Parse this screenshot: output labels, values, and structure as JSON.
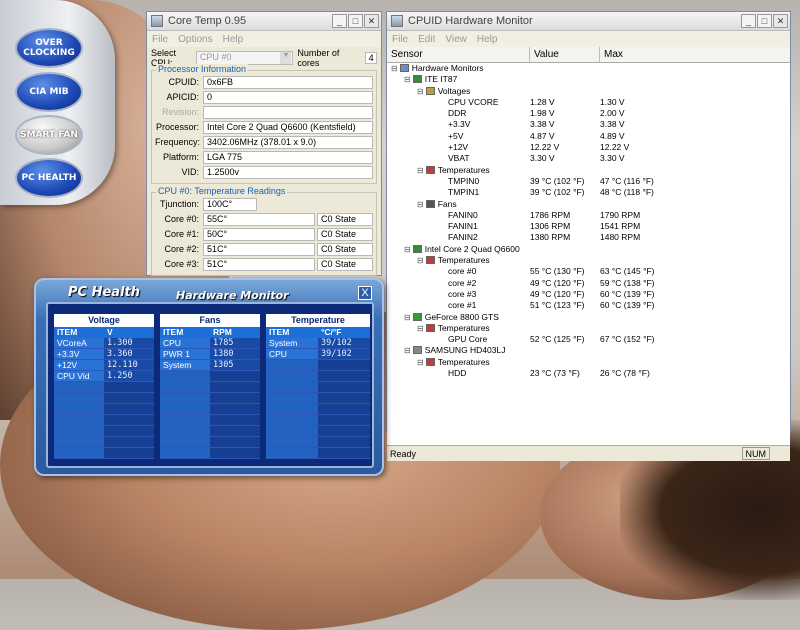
{
  "sidebar": {
    "buttons": [
      {
        "label": "OVER CLOCKING"
      },
      {
        "label": "CIA MIB"
      },
      {
        "label": "SMART FAN"
      },
      {
        "label": "PC HEALTH"
      }
    ]
  },
  "coretemp": {
    "title": "Core Temp 0.95",
    "menu": [
      "File",
      "Options",
      "Help"
    ],
    "select_cpu_label": "Select CPU:",
    "select_cpu_value": "CPU #0",
    "num_cores_label": "Number of cores",
    "num_cores_value": "4",
    "processor_info_title": "Processor Information",
    "fields": [
      {
        "label": "CPUID:",
        "value": "0x6FB"
      },
      {
        "label": "APICID:",
        "value": "0"
      },
      {
        "label": "Revision:",
        "value": ""
      },
      {
        "label": "Processor:",
        "value": "Intel Core 2 Quad Q6600 (Kentsfield)"
      },
      {
        "label": "Frequency:",
        "value": "3402.06MHz (378.01 x 9.0)"
      },
      {
        "label": "Platform:",
        "value": "LGA 775"
      },
      {
        "label": "VID:",
        "value": "1.2500v"
      }
    ],
    "temps_title": "CPU #0: Temperature Readings",
    "tjunction_label": "Tjunction:",
    "tjunction_value": "100C°",
    "cores": [
      {
        "label": "Core #0:",
        "temp": "55C°",
        "state": "C0 State"
      },
      {
        "label": "Core #1:",
        "temp": "50C°",
        "state": "C0 State"
      },
      {
        "label": "Core #2:",
        "temp": "51C°",
        "state": "C0 State"
      },
      {
        "label": "Core #3:",
        "temp": "51C°",
        "state": "C0 State"
      }
    ]
  },
  "hwmon": {
    "title": "CPUID Hardware Monitor",
    "menu": [
      "File",
      "Edit",
      "View",
      "Help"
    ],
    "columns": [
      "Sensor",
      "Value",
      "Max"
    ],
    "rows": [
      {
        "name": "Hardware Monitors",
        "value": "",
        "max": "",
        "level": 0,
        "icon": "computer-icon"
      },
      {
        "name": "ITE IT87",
        "value": "",
        "max": "",
        "level": 1,
        "icon": "chip-icon"
      },
      {
        "name": "Voltages",
        "value": "",
        "max": "",
        "level": 2,
        "icon": "voltage-icon"
      },
      {
        "name": "CPU VCORE",
        "value": "1.28 V",
        "max": "1.30 V",
        "level": 3
      },
      {
        "name": "DDR",
        "value": "1.98 V",
        "max": "2.00 V",
        "level": 3
      },
      {
        "name": "+3.3V",
        "value": "3.38 V",
        "max": "3.38 V",
        "level": 3
      },
      {
        "name": "+5V",
        "value": "4.87 V",
        "max": "4.89 V",
        "level": 3
      },
      {
        "name": "+12V",
        "value": "12.22 V",
        "max": "12.22 V",
        "level": 3
      },
      {
        "name": "VBAT",
        "value": "3.30 V",
        "max": "3.30 V",
        "level": 3
      },
      {
        "name": "Temperatures",
        "value": "",
        "max": "",
        "level": 2,
        "icon": "thermometer-icon"
      },
      {
        "name": "TMPIN0",
        "value": "39 °C (102 °F)",
        "max": "47 °C (116 °F)",
        "level": 3
      },
      {
        "name": "TMPIN1",
        "value": "39 °C (102 °F)",
        "max": "48 °C (118 °F)",
        "level": 3
      },
      {
        "name": "Fans",
        "value": "",
        "max": "",
        "level": 2,
        "icon": "fan-icon"
      },
      {
        "name": "FANIN0",
        "value": "1786 RPM",
        "max": "1790 RPM",
        "level": 3
      },
      {
        "name": "FANIN1",
        "value": "1306 RPM",
        "max": "1541 RPM",
        "level": 3
      },
      {
        "name": "FANIN2",
        "value": "1380 RPM",
        "max": "1480 RPM",
        "level": 3
      },
      {
        "name": "Intel Core 2 Quad Q6600",
        "value": "",
        "max": "",
        "level": 1,
        "icon": "chip-icon"
      },
      {
        "name": "Temperatures",
        "value": "",
        "max": "",
        "level": 2,
        "icon": "thermometer-icon"
      },
      {
        "name": "core #0",
        "value": "55 °C (130 °F)",
        "max": "63 °C (145 °F)",
        "level": 3
      },
      {
        "name": "core #2",
        "value": "49 °C (120 °F)",
        "max": "59 °C (138 °F)",
        "level": 3
      },
      {
        "name": "core #3",
        "value": "49 °C (120 °F)",
        "max": "60 °C (139 °F)",
        "level": 3
      },
      {
        "name": "core #1",
        "value": "51 °C (123 °F)",
        "max": "60 °C (139 °F)",
        "level": 3
      },
      {
        "name": "GeForce 8800 GTS",
        "value": "",
        "max": "",
        "level": 1,
        "icon": "gpu-icon"
      },
      {
        "name": "Temperatures",
        "value": "",
        "max": "",
        "level": 2,
        "icon": "thermometer-icon"
      },
      {
        "name": "GPU Core",
        "value": "52 °C (125 °F)",
        "max": "67 °C (152 °F)",
        "level": 3
      },
      {
        "name": "SAMSUNG HD403LJ",
        "value": "",
        "max": "",
        "level": 1,
        "icon": "disk-icon"
      },
      {
        "name": "Temperatures",
        "value": "",
        "max": "",
        "level": 2,
        "icon": "thermometer-icon"
      },
      {
        "name": "HDD",
        "value": "23 °C (73 °F)",
        "max": "26 °C (78 °F)",
        "level": 3
      }
    ],
    "status": "Ready",
    "num_indicator": "NUM"
  },
  "pchealth": {
    "title": "PC Health",
    "subtitle": "Hardware Monitor",
    "close": "X",
    "voltage": {
      "header": "Voltage",
      "col1": "ITEM",
      "col2": "V",
      "rows": [
        {
          "item": "VCoreA",
          "val": "1.300"
        },
        {
          "item": "+3.3V",
          "val": "3.360"
        },
        {
          "item": "+12V",
          "val": "12.110"
        },
        {
          "item": "CPU Vid",
          "val": "1.250"
        }
      ]
    },
    "fans": {
      "header": "Fans",
      "col1": "ITEM",
      "col2": "RPM",
      "rows": [
        {
          "item": "CPU",
          "val": "1785"
        },
        {
          "item": "PWR 1",
          "val": "1380"
        },
        {
          "item": "System",
          "val": "1305"
        }
      ]
    },
    "temperature": {
      "header": "Temperature",
      "col1": "ITEM",
      "col2": "°C/°F",
      "rows": [
        {
          "item": "System",
          "val": "39/102"
        },
        {
          "item": "CPU",
          "val": "39/102"
        }
      ]
    }
  }
}
